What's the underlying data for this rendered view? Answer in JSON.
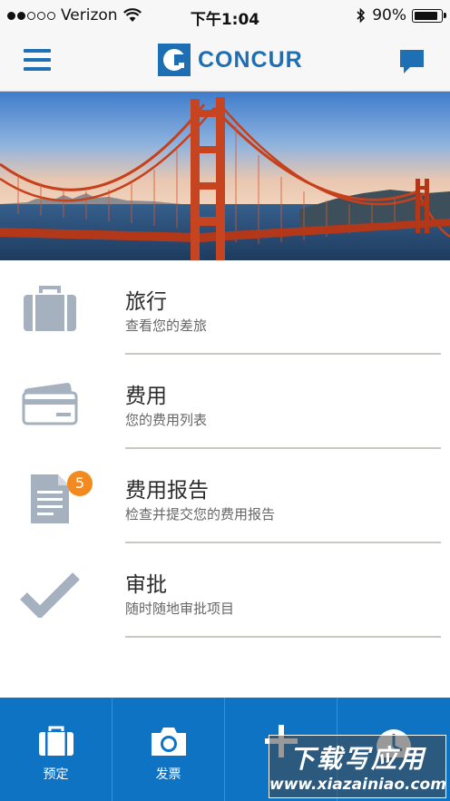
{
  "status_bar": {
    "carrier": "Verizon",
    "time": "下午1:04",
    "battery": "90%",
    "battery_level": 0.9,
    "signal_bars": 2,
    "signal_total": 5
  },
  "nav": {
    "logo_text": "CONCUR",
    "menu_icon": "hamburger-icon",
    "chat_icon": "chat-icon"
  },
  "menu": {
    "items": [
      {
        "title": "旅行",
        "subtitle": "查看您的差旅",
        "icon": "suitcase-icon"
      },
      {
        "title": "费用",
        "subtitle": "您的费用列表",
        "icon": "credit-card-icon"
      },
      {
        "title": "费用报告",
        "subtitle": "检查并提交您的费用报告",
        "icon": "report-icon",
        "badge": "5"
      },
      {
        "title": "审批",
        "subtitle": "随时随地审批项目",
        "icon": "checkmark-icon"
      }
    ]
  },
  "tabs": [
    {
      "label": "预定",
      "icon": "briefcase-icon"
    },
    {
      "label": "发票",
      "icon": "camera-icon"
    },
    {
      "label": "",
      "icon": "plus-icon"
    },
    {
      "label": "",
      "icon": "clock-icon"
    }
  ],
  "watermark": {
    "title": "下载写应用",
    "url": "www.xiazainiao.com"
  },
  "colors": {
    "brand_blue": "#1e6eb4",
    "tab_bar": "#0f73c4",
    "badge": "#f28a20",
    "icon_gray": "#a6b1bf"
  }
}
